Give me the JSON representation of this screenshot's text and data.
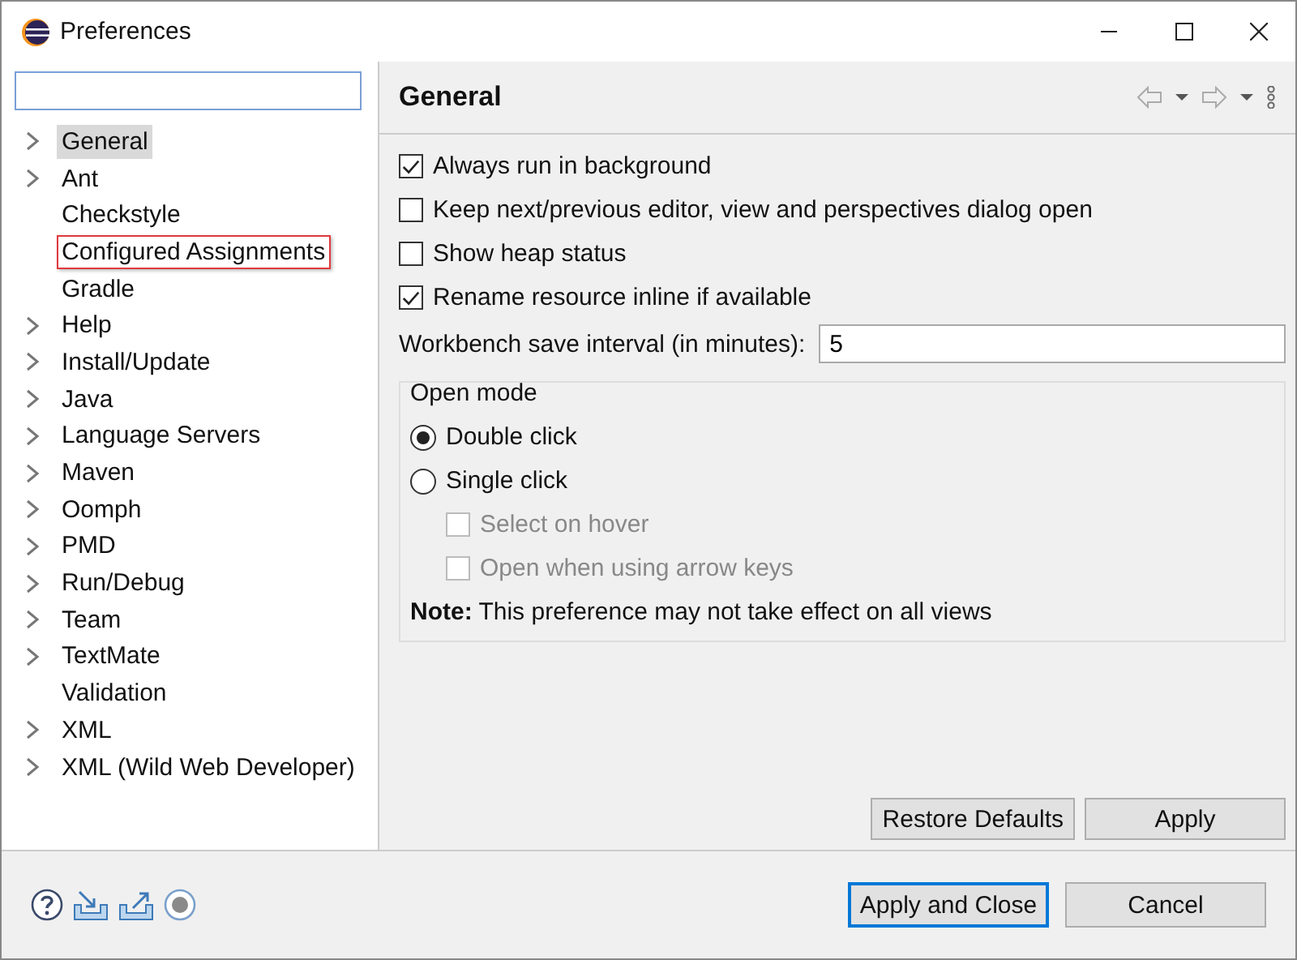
{
  "window": {
    "title": "Preferences"
  },
  "tree": [
    {
      "label": "General",
      "expandable": true,
      "selected": true,
      "highlighted": false
    },
    {
      "label": "Ant",
      "expandable": true,
      "selected": false,
      "highlighted": false
    },
    {
      "label": "Checkstyle",
      "expandable": false,
      "selected": false,
      "highlighted": false
    },
    {
      "label": "Configured Assignments",
      "expandable": false,
      "selected": false,
      "highlighted": true
    },
    {
      "label": "Gradle",
      "expandable": false,
      "selected": false,
      "highlighted": false
    },
    {
      "label": "Help",
      "expandable": true,
      "selected": false,
      "highlighted": false
    },
    {
      "label": "Install/Update",
      "expandable": true,
      "selected": false,
      "highlighted": false
    },
    {
      "label": "Java",
      "expandable": true,
      "selected": false,
      "highlighted": false
    },
    {
      "label": "Language Servers",
      "expandable": true,
      "selected": false,
      "highlighted": false
    },
    {
      "label": "Maven",
      "expandable": true,
      "selected": false,
      "highlighted": false
    },
    {
      "label": "Oomph",
      "expandable": true,
      "selected": false,
      "highlighted": false
    },
    {
      "label": "PMD",
      "expandable": true,
      "selected": false,
      "highlighted": false
    },
    {
      "label": "Run/Debug",
      "expandable": true,
      "selected": false,
      "highlighted": false
    },
    {
      "label": "Team",
      "expandable": true,
      "selected": false,
      "highlighted": false
    },
    {
      "label": "TextMate",
      "expandable": true,
      "selected": false,
      "highlighted": false
    },
    {
      "label": "Validation",
      "expandable": false,
      "selected": false,
      "highlighted": false
    },
    {
      "label": "XML",
      "expandable": true,
      "selected": false,
      "highlighted": false
    },
    {
      "label": "XML (Wild Web Developer)",
      "expandable": true,
      "selected": false,
      "highlighted": false
    }
  ],
  "page": {
    "title": "General",
    "options": [
      {
        "label": "Always run in background",
        "checked": true
      },
      {
        "label": "Keep next/previous editor, view and perspectives dialog open",
        "checked": false
      },
      {
        "label": "Show heap status",
        "checked": false
      },
      {
        "label": "Rename resource inline if available",
        "checked": true
      }
    ],
    "save_interval": {
      "label": "Workbench save interval (in minutes):",
      "value": "5"
    },
    "open_mode": {
      "title": "Open mode",
      "choices": [
        {
          "label": "Double click",
          "selected": true
        },
        {
          "label": "Single click",
          "selected": false
        }
      ],
      "sub_options": [
        {
          "label": "Select on hover",
          "checked": false,
          "disabled": true
        },
        {
          "label": "Open when using arrow keys",
          "checked": false,
          "disabled": true
        }
      ],
      "note": "**Note:** This preference may not take effect on all views"
    },
    "buttons": [
      "Restore Defaults",
      "Apply"
    ]
  },
  "footer": {
    "buttons": [
      {
        "label": "Apply and Close",
        "default": true
      },
      {
        "label": "Cancel",
        "default": false
      }
    ]
  }
}
